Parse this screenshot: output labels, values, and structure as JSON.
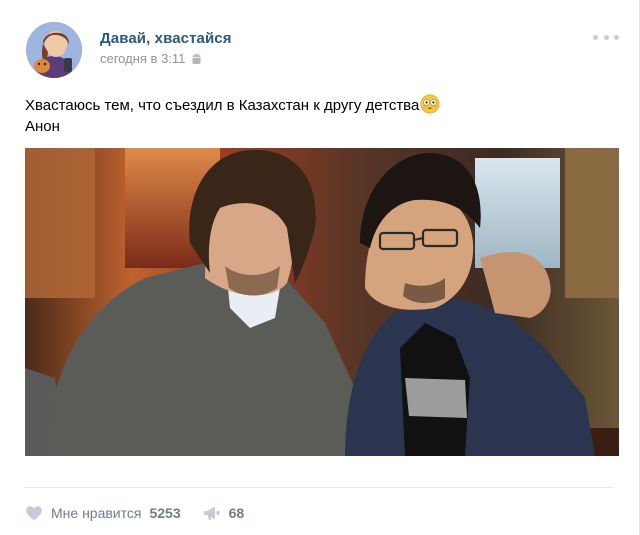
{
  "post": {
    "author": "Давай, хвастайся",
    "time": "сегодня в 3:11",
    "text_line1": "Хвастаюсь тем, что съездил в Казахстан к другу детства",
    "text_line2": "Анон"
  },
  "actions": {
    "like_label": "Мне нравится",
    "like_count": "5253",
    "share_count": "68"
  },
  "colors": {
    "author": "#2a5885",
    "meta": "#939393",
    "action": "#6f7c8b"
  },
  "icons": {
    "device": "android-icon",
    "more": "more-dots-icon",
    "emoji": "flushed-face-icon",
    "like": "heart-icon",
    "share": "megaphone-icon"
  }
}
